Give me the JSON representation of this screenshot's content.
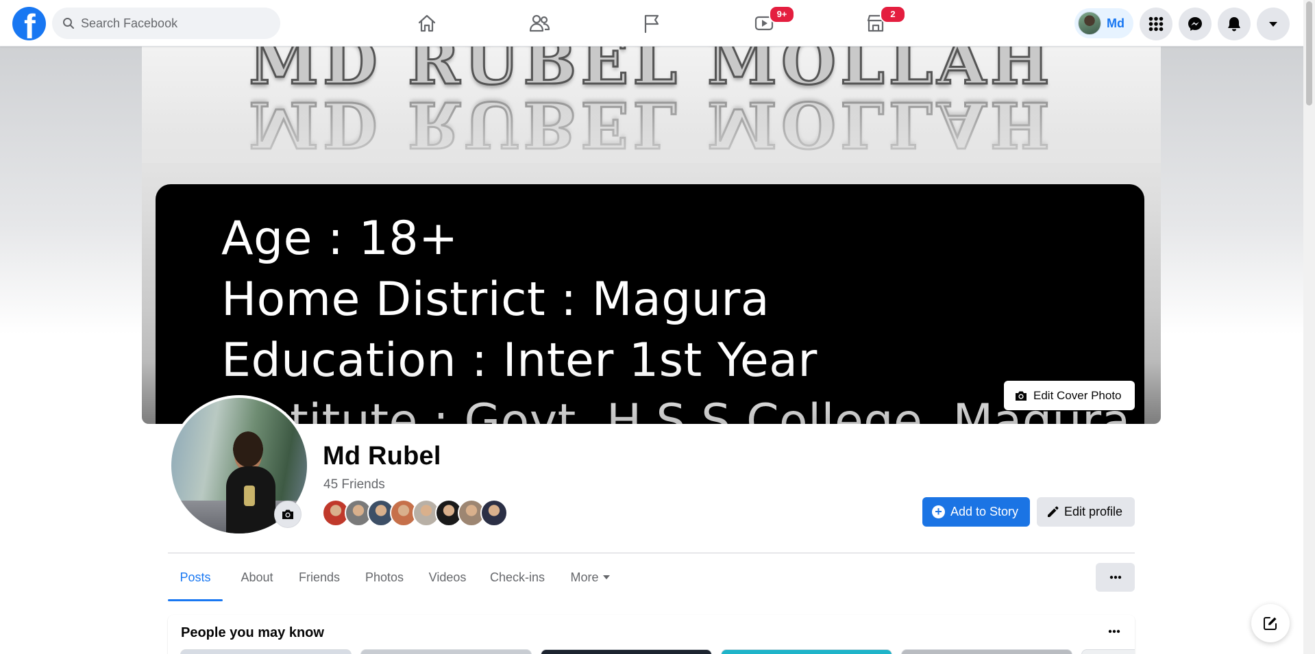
{
  "topbar": {
    "search_placeholder": "Search Facebook",
    "watch_badge": "9+",
    "marketplace_badge": "2",
    "profile_chip_label": "Md"
  },
  "cover": {
    "title_text": "MD RUBEL MOLLAH",
    "lines": [
      "Age : 18+",
      "Home District : Magura",
      "Education : Inter 1st Year",
      "Institute : Govt. H.S.S College, Magura"
    ],
    "edit_cover_label": "Edit Cover Photo"
  },
  "profile": {
    "name": "Md Rubel",
    "friends_count": "45 Friends",
    "friend_face_colors": [
      "#c0392b",
      "#7a7a7a",
      "#3d4f66",
      "#c6704a",
      "#b8b0a6",
      "#1a1a1a",
      "#9d8672",
      "#2b2f45"
    ],
    "add_story_label": "Add to Story",
    "edit_profile_label": "Edit profile"
  },
  "tabs": {
    "items": [
      "Posts",
      "About",
      "Friends",
      "Photos",
      "Videos",
      "Check-ins",
      "More"
    ],
    "active": "Posts"
  },
  "pymk": {
    "title": "People you may know"
  },
  "colors": {
    "accent": "#1877f2",
    "badge": "#e41e3f",
    "secondary_button": "#e4e6eb"
  }
}
